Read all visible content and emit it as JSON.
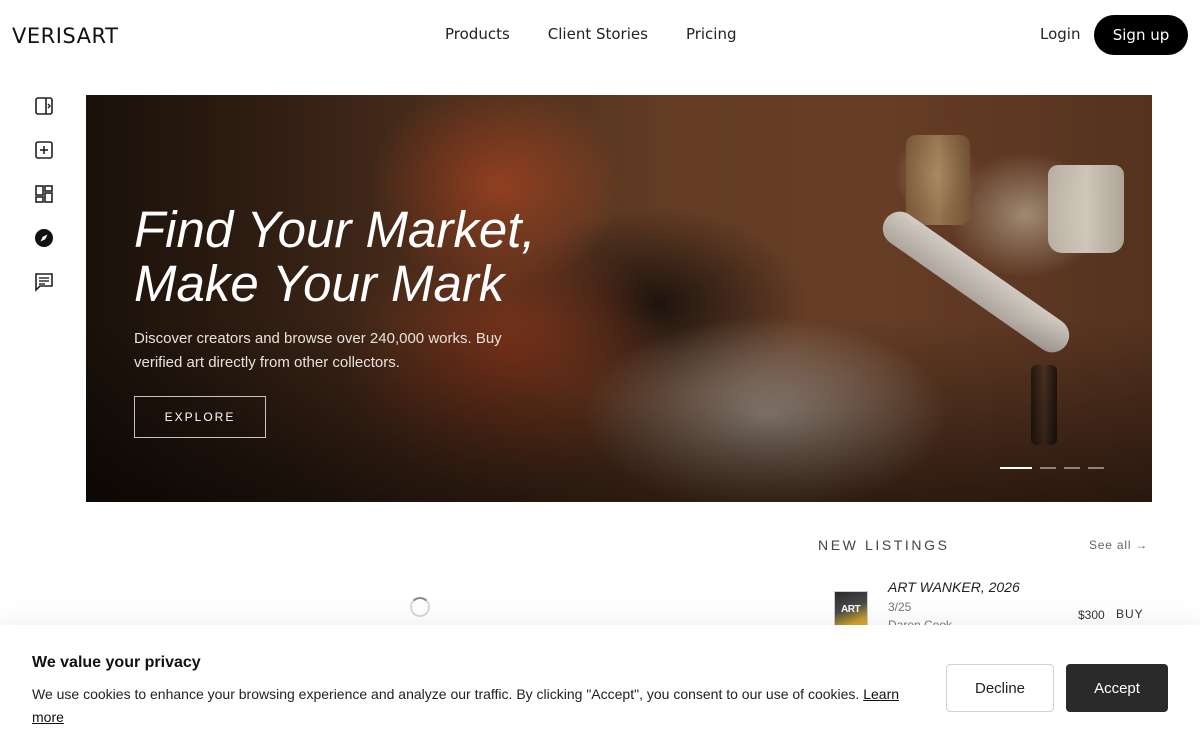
{
  "header": {
    "logo": "VERISART",
    "nav": [
      {
        "label": "Products"
      },
      {
        "label": "Client Stories"
      },
      {
        "label": "Pricing"
      }
    ],
    "login": "Login",
    "signup": "Sign up"
  },
  "sidebar": {
    "icons": [
      "panel-toggle-icon",
      "add-square-icon",
      "dashboard-icon",
      "compass-icon",
      "chat-icon"
    ]
  },
  "hero": {
    "title_line1": "Find Your Market,",
    "title_line2": "Make Your Mark",
    "description": "Discover creators and browse over 240,000 works. Buy verified art directly from other collectors.",
    "cta": "EXPLORE",
    "slides_total": 4,
    "active_slide": 1
  },
  "listings": {
    "title": "NEW LISTINGS",
    "see_all": "See all →",
    "items": [
      {
        "title": "ART WANKER, 2026",
        "edition": "3/25",
        "artist": "Daren Cook",
        "price": "$300",
        "action": "BUY",
        "thumb_text": "ART"
      }
    ]
  },
  "cookie": {
    "title": "We value your privacy",
    "text": "We use cookies to enhance your browsing experience and analyze our traffic. By clicking \"Accept\", you consent to our use of cookies.",
    "link": "Learn more",
    "decline": "Decline",
    "accept": "Accept"
  }
}
